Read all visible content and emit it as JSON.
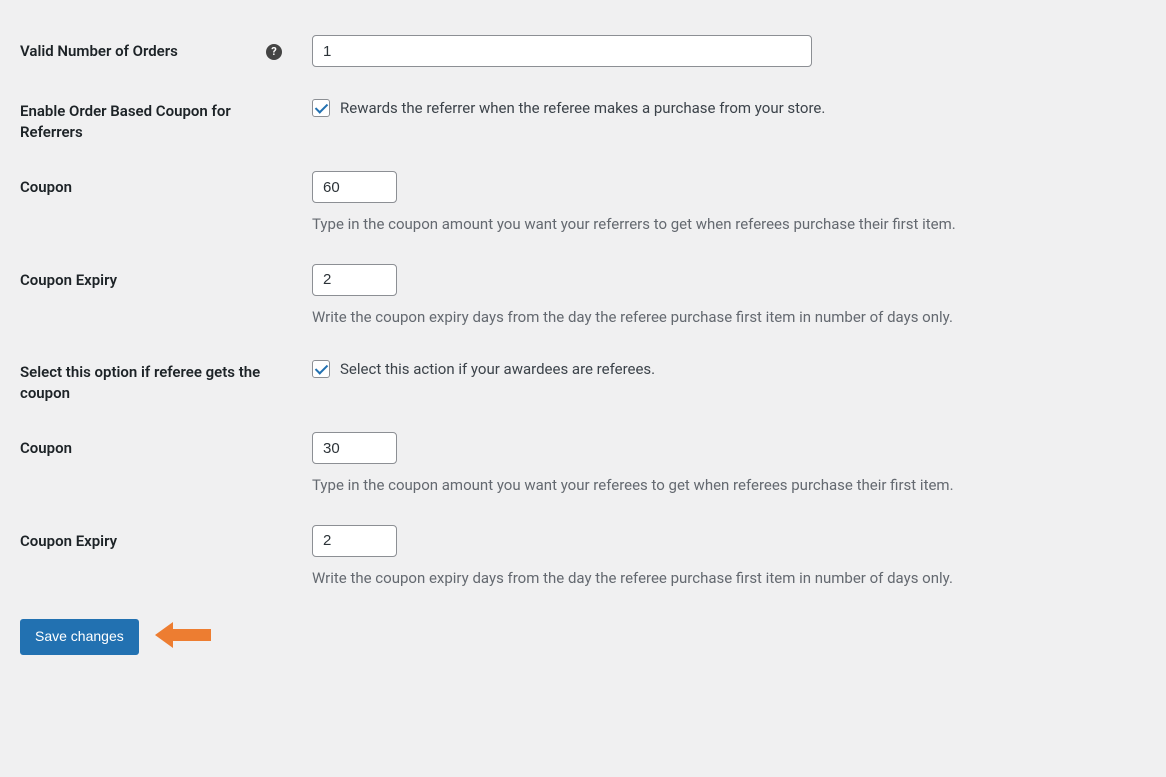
{
  "form": {
    "valid_orders": {
      "label": "Valid Number of Orders",
      "value": "1",
      "help_icon": "?"
    },
    "enable_order_coupon": {
      "label": "Enable Order Based Coupon for Referrers",
      "checked": true,
      "description": "Rewards the referrer when the referee makes a purchase from your store."
    },
    "referrer_coupon": {
      "label": "Coupon",
      "value": "60",
      "description": "Type in the coupon amount you want your referrers to get when referees purchase their first item."
    },
    "referrer_coupon_expiry": {
      "label": "Coupon Expiry",
      "value": "2",
      "description": "Write the coupon expiry days from the day the referee purchase first item in number of days only."
    },
    "referee_option": {
      "label": "Select this option if referee gets the coupon",
      "checked": true,
      "description": "Select this action if your awardees are referees."
    },
    "referee_coupon": {
      "label": "Coupon",
      "value": "30",
      "description": "Type in the coupon amount you want your referees to get when referees purchase their first item."
    },
    "referee_coupon_expiry": {
      "label": "Coupon Expiry",
      "value": "2",
      "description": "Write the coupon expiry days from the day the referee purchase first item in number of days only."
    },
    "submit": {
      "label": "Save changes"
    }
  }
}
